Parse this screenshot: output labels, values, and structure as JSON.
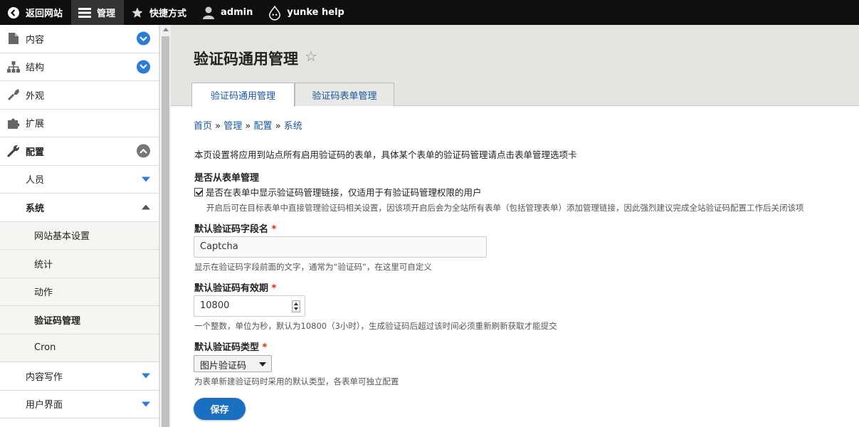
{
  "toolbar": {
    "back": "返回网站",
    "manage": "管理",
    "shortcuts": "快捷方式",
    "user": "admin",
    "help": "yunke help"
  },
  "sidebar": {
    "items": [
      {
        "label": "内容",
        "icon": "document-icon",
        "toggle": "expand"
      },
      {
        "label": "结构",
        "icon": "sitemap-icon",
        "toggle": "expand"
      },
      {
        "label": "外观",
        "icon": "paintbrush-icon"
      },
      {
        "label": "扩展",
        "icon": "puzzle-icon"
      },
      {
        "label": "配置",
        "icon": "wrench-icon",
        "toggle": "collapse"
      }
    ],
    "config_children": [
      {
        "label": "人员",
        "toggle": "down"
      },
      {
        "label": "系统",
        "toggle": "up"
      }
    ],
    "system_children": [
      "网站基本设置",
      "统计",
      "动作",
      "验证码管理",
      "Cron"
    ],
    "more_children": [
      {
        "label": "内容写作",
        "toggle": "down"
      },
      {
        "label": "用户界面",
        "toggle": "down"
      }
    ]
  },
  "page": {
    "title": "验证码通用管理",
    "tabs": [
      "验证码通用管理",
      "验证码表单管理"
    ],
    "breadcrumb": [
      "首页",
      "管理",
      "配置",
      "系统"
    ],
    "breadcrumb_sep": "»",
    "intro": "本页设置将应用到站点所有启用验证码的表单，具体某个表单的验证码管理请点击表单管理选项卡"
  },
  "form": {
    "form_manage_label": "是否从表单管理",
    "form_manage_checkbox": "是否在表单中显示验证码管理链接，仅适用于有验证码管理权限的用户",
    "form_manage_desc": "开启后可在目标表单中直接管理验证码相关设置，因该项开启后会为全站所有表单（包括管理表单）添加管理链接，因此强烈建议完成全站验证码配置工作后关闭该项",
    "field_name_label": "默认验证码字段名",
    "field_name_value": "Captcha",
    "field_name_desc": "显示在验证码字段前面的文字，通常为“验证码”，在这里可自定义",
    "validity_label": "默认验证码有效期",
    "validity_value": "10800",
    "validity_desc": "一个整数，单位为秒，默认为10800（3小时），生成验证码后超过该时间必须重新刷新获取才能提交",
    "type_label": "默认验证码类型",
    "type_value": "图片验证码",
    "type_desc": "为表单新建验证码时采用的默认类型，各表单可独立配置",
    "required_mark": "*",
    "save_label": "保存"
  },
  "colors": {
    "accent": "#1b6fc0",
    "toolbar": "#0f0f0f",
    "link": "#1a56a8",
    "required": "#e62600"
  }
}
